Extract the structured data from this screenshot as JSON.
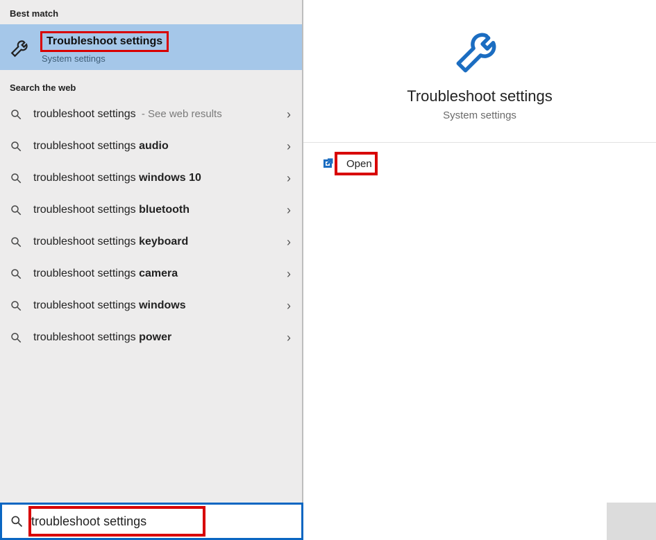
{
  "left": {
    "best_header": "Best match",
    "best_title": "Troubleshoot settings",
    "best_sub": "System settings",
    "web_header": "Search the web",
    "web_items": [
      {
        "base": "troubleshoot settings",
        "bold": "",
        "hint": " - See web results"
      },
      {
        "base": "troubleshoot settings ",
        "bold": "audio",
        "hint": ""
      },
      {
        "base": "troubleshoot settings ",
        "bold": "windows 10",
        "hint": ""
      },
      {
        "base": "troubleshoot settings ",
        "bold": "bluetooth",
        "hint": ""
      },
      {
        "base": "troubleshoot settings ",
        "bold": "keyboard",
        "hint": ""
      },
      {
        "base": "troubleshoot settings ",
        "bold": "camera",
        "hint": ""
      },
      {
        "base": "troubleshoot settings ",
        "bold": "windows",
        "hint": ""
      },
      {
        "base": "troubleshoot settings ",
        "bold": "power",
        "hint": ""
      }
    ],
    "search_value": "troubleshoot settings"
  },
  "right": {
    "title": "Troubleshoot settings",
    "sub": "System settings",
    "open": "Open"
  },
  "taskbar_icons": [
    "cortana",
    "task-view",
    "chrome",
    "file-explorer",
    "word"
  ]
}
